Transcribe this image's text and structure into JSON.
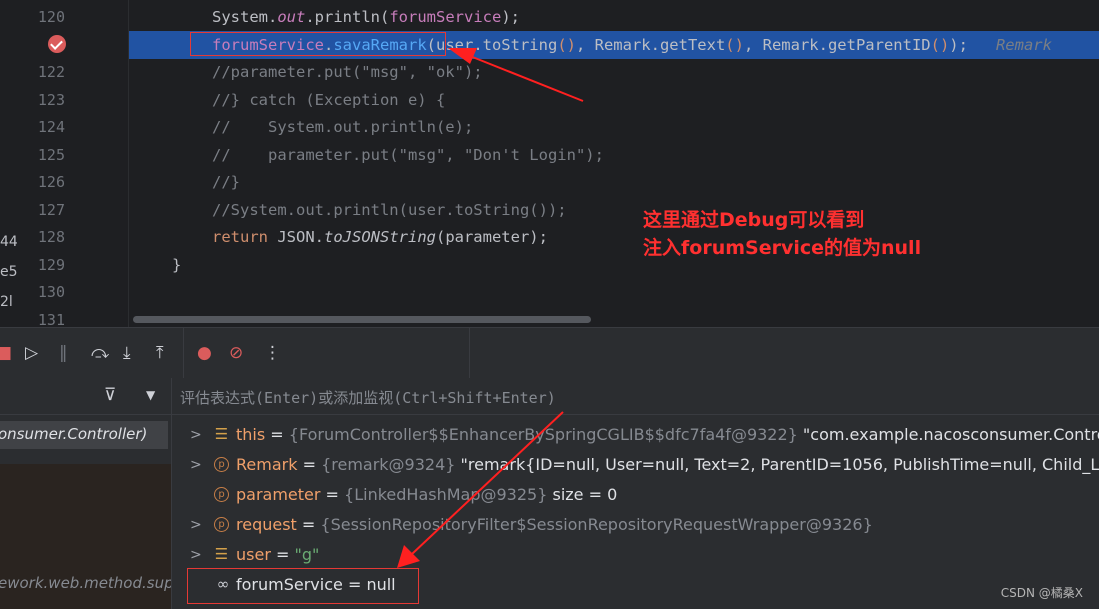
{
  "editor": {
    "left_clip_fragments": [
      "44",
      "e5",
      "2l"
    ],
    "lines": [
      {
        "num": "120",
        "tokens": [
          {
            "t": "System.",
            "c": ""
          },
          {
            "t": "out",
            "c": "pur it"
          },
          {
            "t": ".println(",
            "c": ""
          },
          {
            "t": "forumService",
            "c": "pur"
          },
          {
            "t": ");",
            "c": ""
          }
        ]
      },
      {
        "num": "",
        "tokens": [
          {
            "t": "forumService",
            "c": "pur"
          },
          {
            "t": ".",
            "c": ""
          },
          {
            "t": "savaRemark",
            "c": "fn"
          },
          {
            "t": "(user.toString",
            "c": ""
          },
          {
            "t": "()",
            "c": "kw"
          },
          {
            "t": ", Remark.getText",
            "c": ""
          },
          {
            "t": "()",
            "c": "kw"
          },
          {
            "t": ", Remark.getParentID",
            "c": ""
          },
          {
            "t": "()",
            "c": "kw"
          },
          {
            "t": ");   ",
            "c": ""
          },
          {
            "t": "Remark",
            "c": "hint"
          }
        ]
      },
      {
        "num": "122",
        "tokens": [
          {
            "t": "//parameter.put(\"msg\", \"ok\");",
            "c": "cm"
          }
        ]
      },
      {
        "num": "123",
        "tokens": [
          {
            "t": "//} catch (Exception e) {",
            "c": "cm"
          }
        ]
      },
      {
        "num": "124",
        "tokens": [
          {
            "t": "//    System.out.println(e);",
            "c": "cm"
          }
        ]
      },
      {
        "num": "125",
        "tokens": [
          {
            "t": "//    parameter.put(\"msg\", \"Don't Login\");",
            "c": "cm"
          }
        ]
      },
      {
        "num": "126",
        "tokens": [
          {
            "t": "//}",
            "c": "cm"
          }
        ]
      },
      {
        "num": "127",
        "tokens": [
          {
            "t": "//System.out.println(user.toString());",
            "c": "cm"
          }
        ]
      },
      {
        "num": "128",
        "tokens": [
          {
            "t": "return ",
            "c": "kw"
          },
          {
            "t": "JSON.",
            "c": ""
          },
          {
            "t": "toJSONString",
            "c": "it"
          },
          {
            "t": "(parameter);",
            "c": ""
          }
        ]
      },
      {
        "num": "129",
        "tokens": [
          {
            "t": "}",
            "c": ""
          }
        ]
      },
      {
        "num": "130",
        "tokens": []
      },
      {
        "num": "131",
        "tokens": []
      }
    ],
    "annotation": [
      "这里通过Debug可以看到",
      "注入forumService的值为null"
    ]
  },
  "toolbar": {
    "icons": [
      "stop-icon",
      "resume-icon",
      "pause-icon",
      "step-over-icon",
      "step-into-icon",
      "step-out-icon",
      "view-breakpoints-icon",
      "mute-breakpoints-icon",
      "more-icon"
    ]
  },
  "frames": {
    "selected": "onsumer.Controller)",
    "other": "ework.web.method.sup"
  },
  "variables": {
    "eval_placeholder": "评估表达式(Enter)或添加监视(Ctrl+Shift+Enter)",
    "items": [
      {
        "expand": ">",
        "icon": "stack",
        "name": "this",
        "type": "{ForumController$$EnhancerBySpringCGLIB$$dfc7fa4f@9322}",
        "value": " \"com.example.nacosconsumer.Controller.",
        "str": false
      },
      {
        "expand": ">",
        "icon": "p",
        "name": "Remark",
        "type": "{remark@9324}",
        "value": " \"remark{ID=null, User=null, Text=2, ParentID=1056, PublishTime=null, Child_List=null}\"",
        "str": false
      },
      {
        "expand": "",
        "icon": "p",
        "name": "parameter",
        "type": "{LinkedHashMap@9325}",
        "value": "  size = 0",
        "str": false
      },
      {
        "expand": ">",
        "icon": "p",
        "name": "request",
        "type": "{SessionRepositoryFilter$SessionRepositoryRequestWrapper@9326}",
        "value": "",
        "str": false
      },
      {
        "expand": ">",
        "icon": "stack",
        "name": "user",
        "type": "",
        "value": "\"g\"",
        "str": true
      },
      {
        "expand": "",
        "icon": "glasses",
        "name": "forumService",
        "type": "",
        "value": "null",
        "str": false
      }
    ]
  },
  "watermark": "CSDN @橘桑X",
  "colors": {
    "annotation": "#ff3030",
    "highlight": "#2153a3",
    "breakpoint": "#db5c5c"
  }
}
